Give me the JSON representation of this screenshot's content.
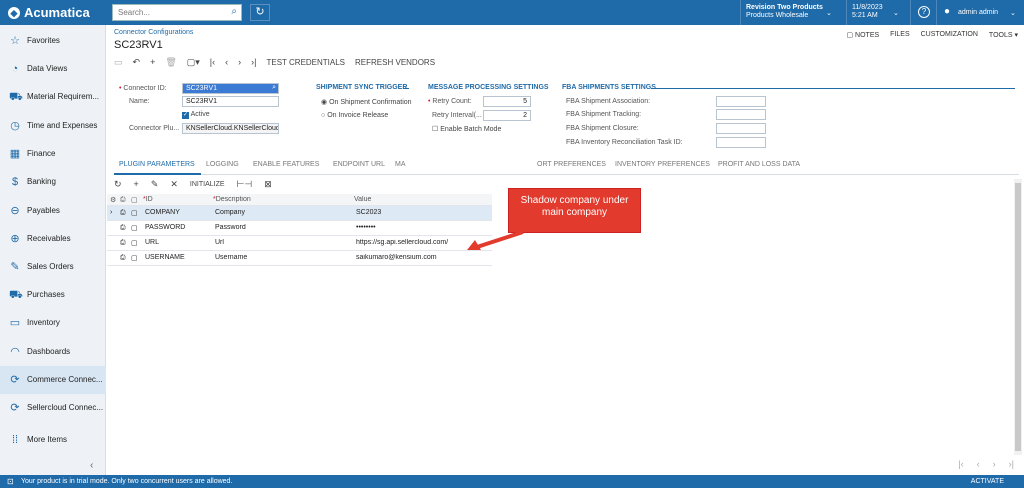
{
  "app": {
    "brand": "Acumatica",
    "search_placeholder": "Search...",
    "company_line1": "Revision Two Products",
    "company_line2": "Products Wholesale",
    "date": "11/8/2023",
    "time": "5:21 AM",
    "user": "admin admin"
  },
  "sidebar": {
    "items": [
      {
        "label": "Favorites",
        "icon": "star-icon"
      },
      {
        "label": "Data Views",
        "icon": "pie-icon"
      },
      {
        "label": "Material Requirem...",
        "icon": "cart-icon"
      },
      {
        "label": "Time and Expenses",
        "icon": "clock-icon"
      },
      {
        "label": "Finance",
        "icon": "calculator-icon"
      },
      {
        "label": "Banking",
        "icon": "dollar-icon"
      },
      {
        "label": "Payables",
        "icon": "minus-circle-icon"
      },
      {
        "label": "Receivables",
        "icon": "plus-circle-icon"
      },
      {
        "label": "Sales Orders",
        "icon": "edit-icon"
      },
      {
        "label": "Purchases",
        "icon": "cart-icon"
      },
      {
        "label": "Inventory",
        "icon": "truck-icon"
      },
      {
        "label": "Dashboards",
        "icon": "gauge-icon"
      },
      {
        "label": "Commerce Connec...",
        "icon": "sync-icon"
      },
      {
        "label": "Sellercloud Connec...",
        "icon": "sync-icon"
      },
      {
        "label": "More Items",
        "icon": "grid-icon"
      }
    ],
    "active_index": 12
  },
  "page": {
    "breadcrumb": "Connector Configurations",
    "title": "SC23RV1",
    "top_actions": [
      "NOTES",
      "FILES",
      "CUSTOMIZATION",
      "TOOLS"
    ],
    "toolbar": {
      "test_credentials": "TEST CREDENTIALS",
      "refresh_vendors": "REFRESH VENDORS"
    }
  },
  "form": {
    "connector_id_label": "Connector ID:",
    "connector_id": "SC23RV1",
    "name_label": "Name:",
    "name": "SC23RV1",
    "active_label": "Active",
    "connector_plugin_label": "Connector Plu...",
    "connector_plugin": "KNSellerCloud.KNSellerCloudC",
    "shipment_sync": {
      "title": "SHIPMENT SYNC TRIGGER",
      "option1": "On Shipment Confirmation",
      "option2": "On Invoice Release"
    },
    "message_processing": {
      "title": "MESSAGE PROCESSING SETTINGS",
      "retry_count_label": "Retry Count:",
      "retry_count": "5",
      "retry_interval_label": "Retry Interval(...",
      "retry_interval": "2",
      "batch_mode_label": "Enable Batch Mode"
    },
    "fba": {
      "title": "FBA SHIPMENTS SETTINGS",
      "fields": [
        "FBA Shipment Association:",
        "FBA Shipment Tracking:",
        "FBA Shipment Closure:",
        "FBA Inventory Reconciliation Task ID:"
      ]
    }
  },
  "tabs": [
    "PLUGIN PARAMETERS",
    "LOGGING",
    "ENABLE FEATURES",
    "ENDPOINT URL",
    "MA",
    "ORT PREFERENCES",
    "INVENTORY PREFERENCES",
    "PROFIT AND LOSS DATA"
  ],
  "grid": {
    "initialize_label": "INITIALIZE",
    "columns": [
      "ID",
      "Description",
      "Value"
    ],
    "rows": [
      {
        "id": "COMPANY",
        "description": "Company",
        "value": "SC2023"
      },
      {
        "id": "PASSWORD",
        "description": "Password",
        "value": "••••••••"
      },
      {
        "id": "URL",
        "description": "Url",
        "value": "https://sg.api.sellercloud.com/"
      },
      {
        "id": "USERNAME",
        "description": "Username",
        "value": "saikumaro@kensium.com"
      }
    ]
  },
  "annotation": {
    "text_line1": "Shadow company under",
    "text_line2": "main company"
  },
  "status": {
    "message": "Your product is in trial mode. Only two concurrent users are allowed.",
    "activate": "ACTIVATE"
  }
}
